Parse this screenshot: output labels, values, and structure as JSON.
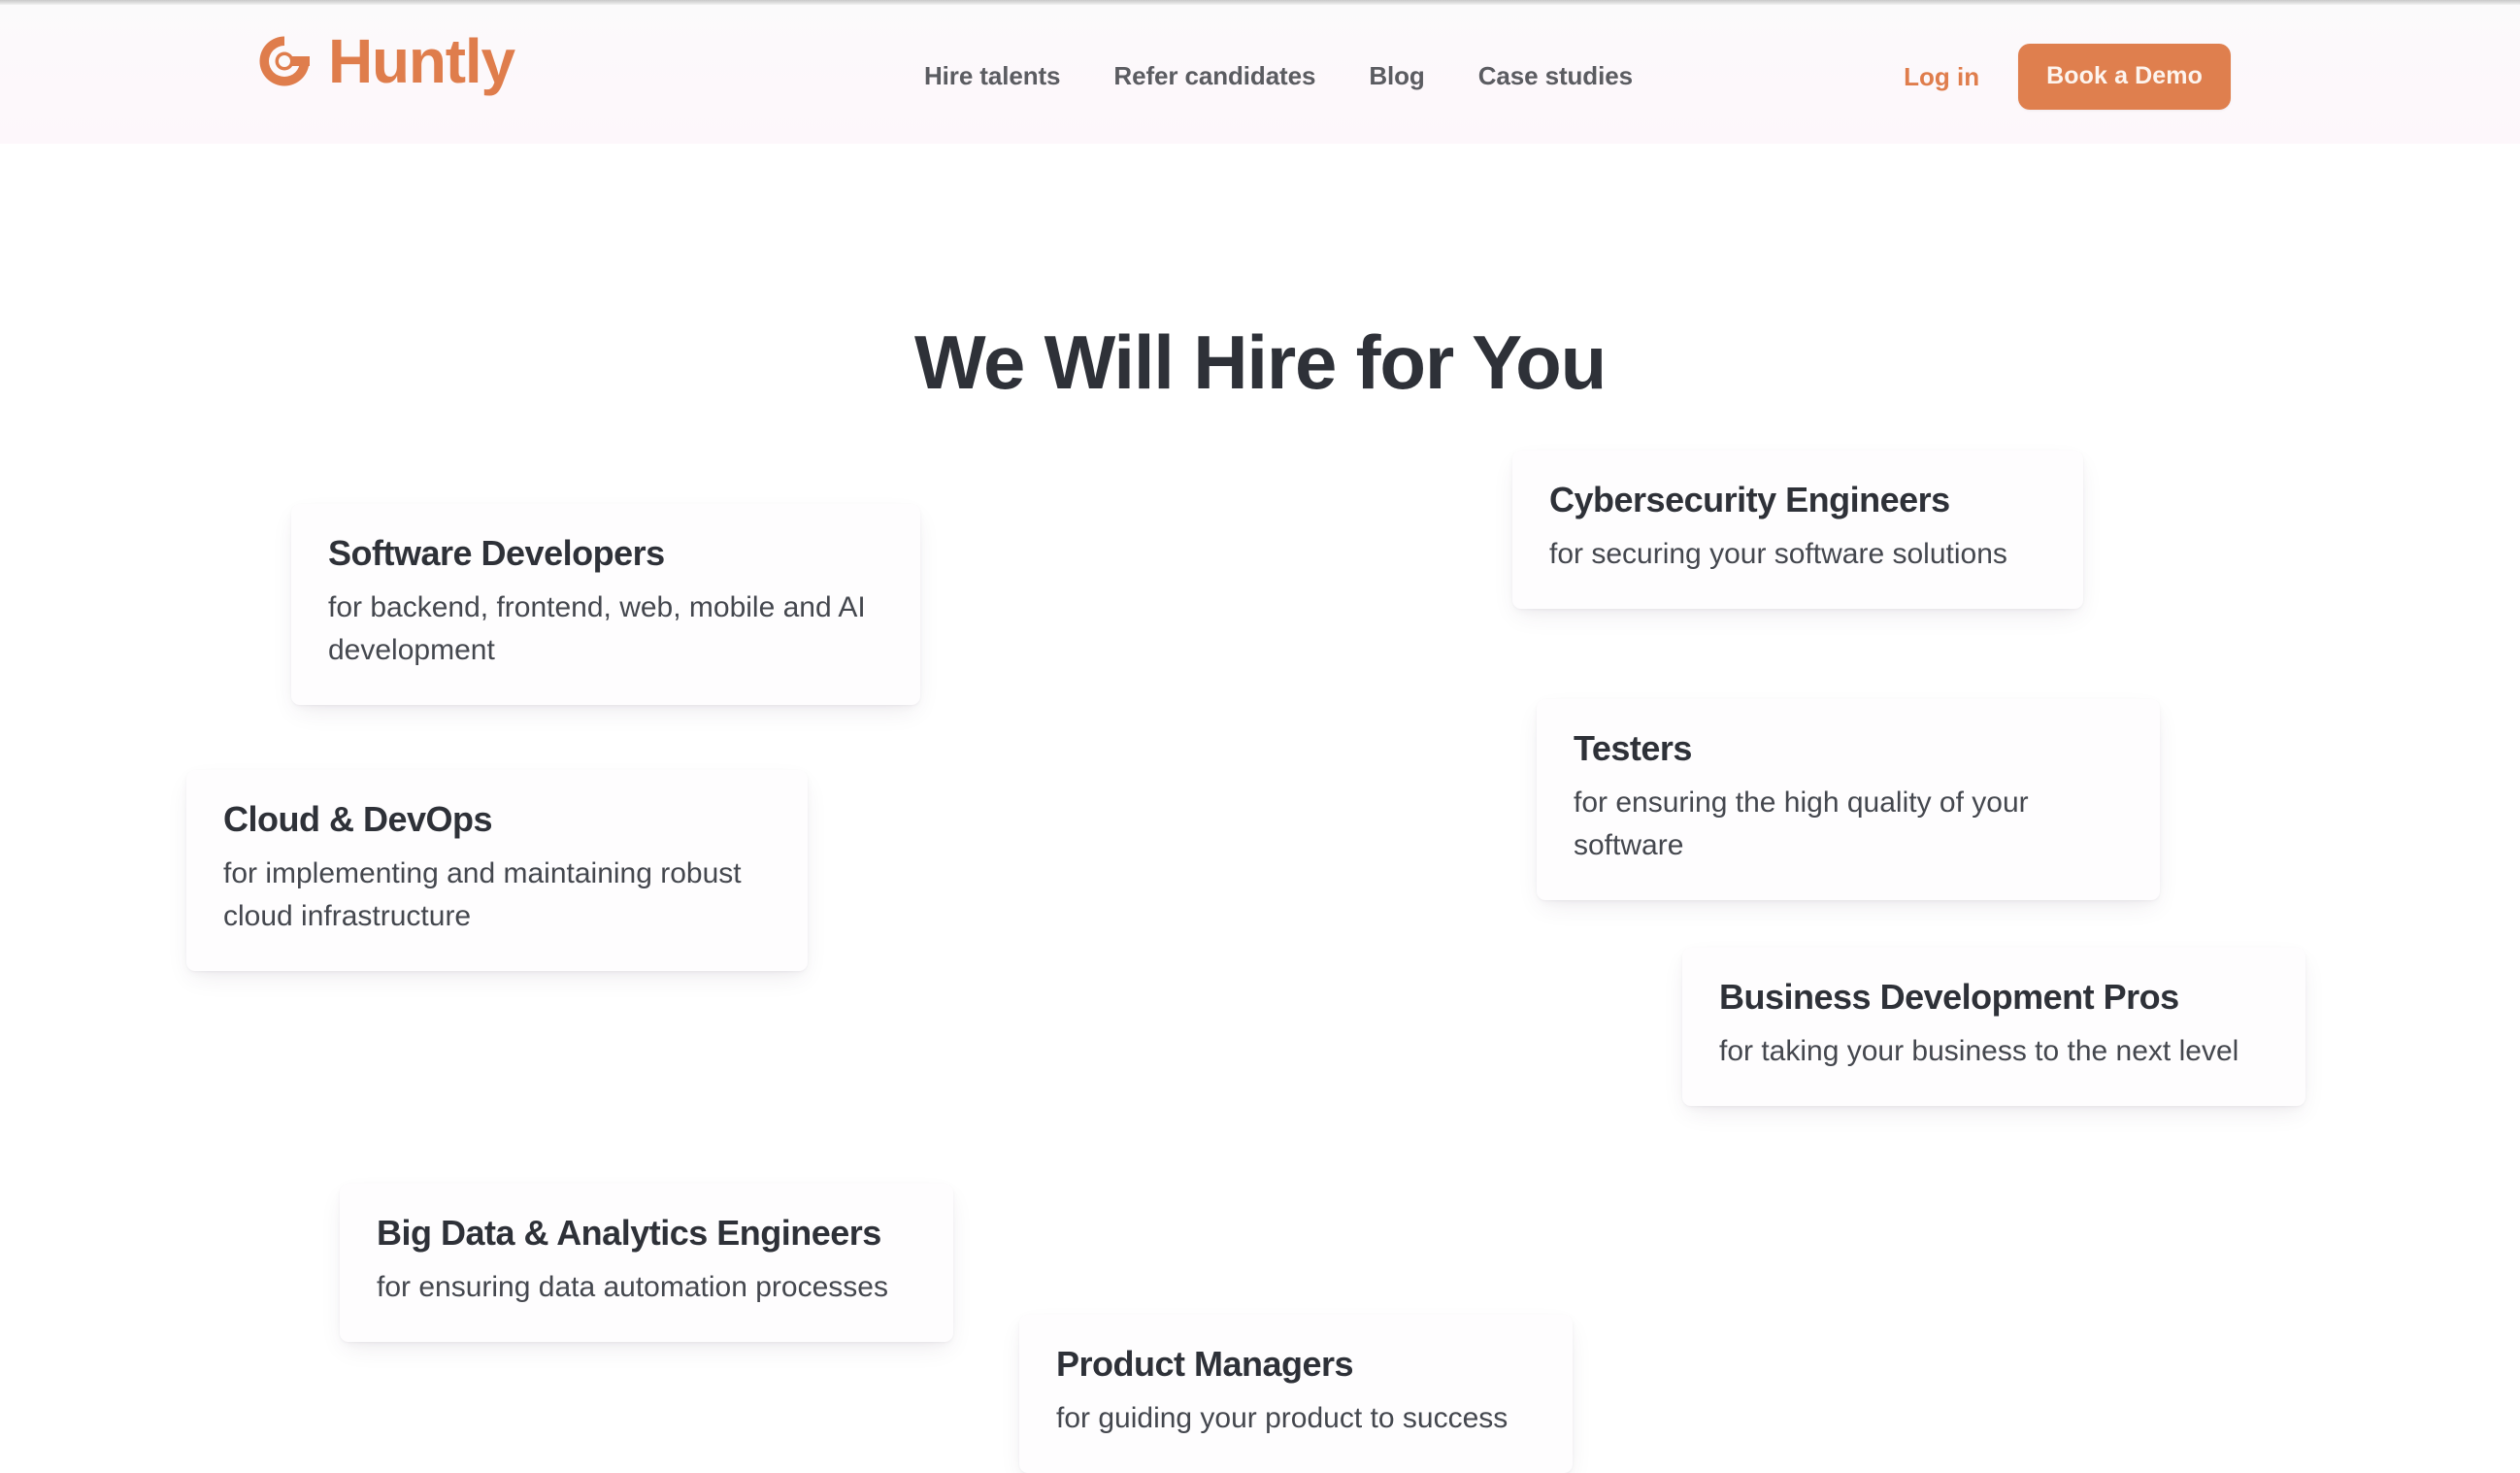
{
  "brand": {
    "name": "Huntly",
    "logo_icon": "huntly-circle-mark",
    "accent_color": "#df7f4e",
    "text_color": "#2e3138"
  },
  "header": {
    "nav": [
      {
        "label": "Hire talents"
      },
      {
        "label": "Refer candidates"
      },
      {
        "label": "Blog"
      },
      {
        "label": "Case studies"
      }
    ],
    "login_label": "Log in",
    "demo_label": "Book a Demo"
  },
  "main": {
    "title": "We Will Hire for You",
    "cards": [
      {
        "id": "software-developers",
        "title": "Software Developers",
        "desc": "for backend, frontend, web, mobile and AI development"
      },
      {
        "id": "cloud-devops",
        "title": "Cloud & DevOps",
        "desc": "for implementing and maintaining robust cloud infrastructure"
      },
      {
        "id": "big-data",
        "title": "Big Data & Analytics Engineers",
        "desc": "for ensuring data automation processes"
      },
      {
        "id": "product-managers",
        "title": "Product Managers",
        "desc": "for guiding your product to success"
      },
      {
        "id": "cybersecurity",
        "title": "Cybersecurity Engineers",
        "desc": "for securing your software solutions"
      },
      {
        "id": "testers",
        "title": "Testers",
        "desc": "for ensuring the high quality of your software"
      },
      {
        "id": "bizdev",
        "title": "Business Development Pros",
        "desc": "for taking your business to the next level"
      }
    ]
  }
}
